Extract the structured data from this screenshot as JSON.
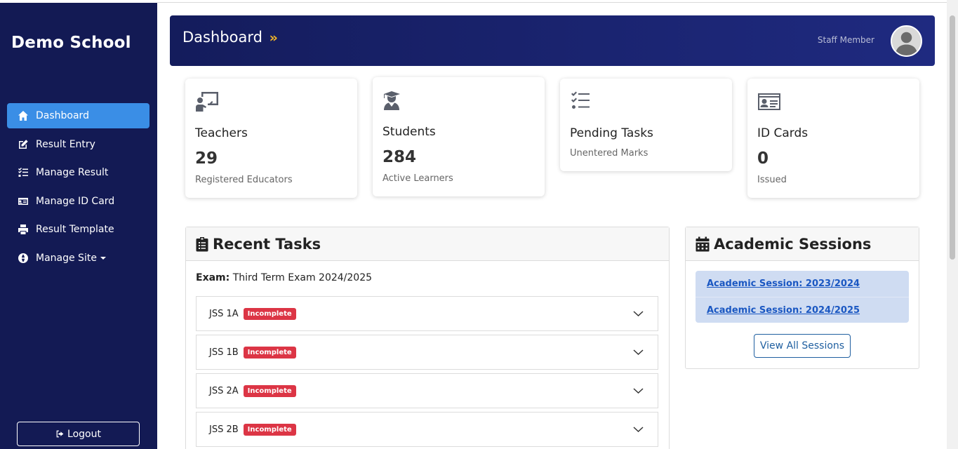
{
  "sidebar": {
    "brand": "Demo School",
    "items": [
      {
        "label": "Dashboard",
        "icon": "home-icon",
        "active": true
      },
      {
        "label": "Result Entry",
        "icon": "edit-icon"
      },
      {
        "label": "Manage Result",
        "icon": "list-check-icon"
      },
      {
        "label": "Manage ID Card",
        "icon": "id-card-icon"
      },
      {
        "label": "Result Template",
        "icon": "print-icon"
      },
      {
        "label": "Manage Site",
        "icon": "globe-icon",
        "dropdown": true
      }
    ],
    "logout_label": "Logout"
  },
  "header": {
    "title": "Dashboard",
    "title_suffix": "»",
    "user_label": "Staff Member"
  },
  "stats": [
    {
      "title": "Teachers",
      "value": "29",
      "subtitle": "Registered Educators",
      "icon": "chalkboard-teacher-icon"
    },
    {
      "title": "Students",
      "value": "284",
      "subtitle": "Active Learners",
      "icon": "graduate-icon"
    },
    {
      "title": "Pending Tasks",
      "value": "",
      "subtitle": "Unentered Marks",
      "icon": "tasks-icon"
    },
    {
      "title": "ID Cards",
      "value": "0",
      "subtitle": "Issued",
      "icon": "id-card-icon"
    }
  ],
  "recent_tasks": {
    "heading": "Recent Tasks",
    "exam_label": "Exam:",
    "exam_value": "Third Term Exam 2024/2025",
    "classes": [
      {
        "name": "JSS 1A",
        "status": "Incomplete"
      },
      {
        "name": "JSS 1B",
        "status": "Incomplete"
      },
      {
        "name": "JSS 2A",
        "status": "Incomplete"
      },
      {
        "name": "JSS 2B",
        "status": "Incomplete"
      }
    ]
  },
  "sessions": {
    "heading": "Academic Sessions",
    "items": [
      {
        "label": "Academic Session: 2023/2024"
      },
      {
        "label": "Academic Session: 2024/2025"
      }
    ],
    "view_all_label": "View All Sessions"
  },
  "colors": {
    "sidebar_bg": "#131a54",
    "active_item": "#3a8ee6",
    "header_bg": "#1a2370",
    "badge_danger": "#dc3545",
    "accent_gold": "#f0b429",
    "link_blue": "#1a57c2"
  }
}
